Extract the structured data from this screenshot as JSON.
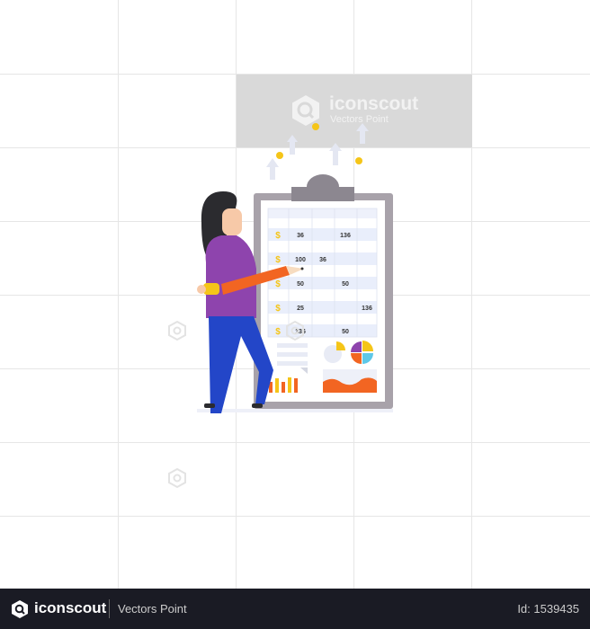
{
  "watermark": {
    "brand": "iconscout",
    "author": "Vectors Point"
  },
  "table": {
    "currency_symbol": "$",
    "rows": [
      [
        "36",
        "",
        "136",
        ""
      ],
      [
        "100",
        "36",
        "",
        ""
      ],
      [
        "50",
        "",
        "50",
        ""
      ],
      [
        "25",
        "",
        "",
        "136"
      ],
      [
        "136",
        "",
        "50",
        ""
      ]
    ]
  },
  "footer": {
    "brand": "iconscout",
    "author": "Vectors Point",
    "id": "Id: 1539435"
  },
  "colors": {
    "footer_bg": "#1a1b24",
    "shirt": "#8e44ad",
    "pants": "#2346c8",
    "pencil": "#f26522",
    "coin": "#f5c518"
  }
}
